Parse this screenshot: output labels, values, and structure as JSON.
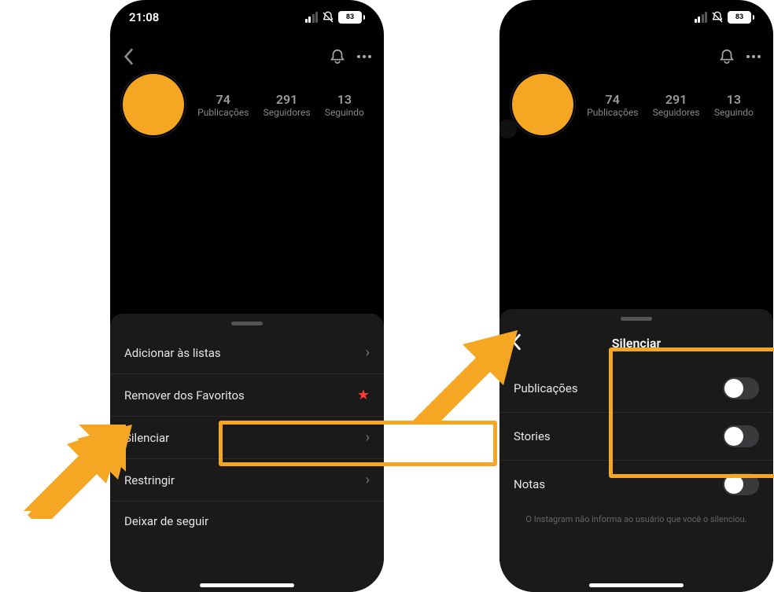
{
  "status": {
    "time": "21:08",
    "battery": "83"
  },
  "stats": {
    "posts_count": "74",
    "posts_label": "Publicações",
    "followers_count": "291",
    "followers_label": "Seguidores",
    "following_count": "13",
    "following_label": "Seguindo"
  },
  "sheet_left": {
    "items": {
      "add_lists": "Adicionar às listas",
      "remove_favorites": "Remover dos Favoritos",
      "silence": "Silenciar",
      "restrict": "Restringir",
      "unfollow": "Deixar de seguir"
    }
  },
  "sheet_right": {
    "title": "Silenciar",
    "rows": {
      "posts": "Publicações",
      "stories": "Stories",
      "notes": "Notas"
    },
    "footnote": "O Instagram não informa ao usuário que você o silenciou."
  }
}
